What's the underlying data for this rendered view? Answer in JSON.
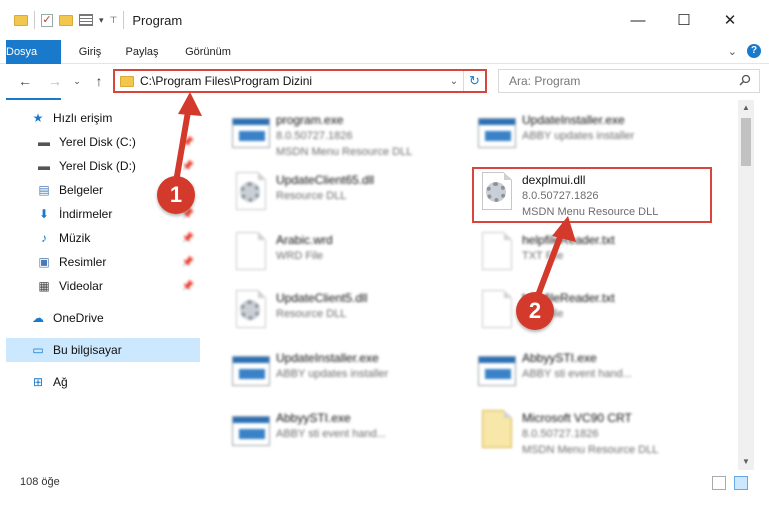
{
  "window": {
    "title": "Program"
  },
  "ribbon": {
    "tabs": [
      "Dosya",
      "Giriş",
      "Paylaş",
      "Görünüm"
    ]
  },
  "address": {
    "path": "C:\\Program Files\\Program Dizini"
  },
  "search": {
    "placeholder": "Ara: Program"
  },
  "sidebar": {
    "items": [
      {
        "label": "Hızlı erişim",
        "icon": "star-icon"
      },
      {
        "label": "Yerel Disk (C:)",
        "icon": "drive-icon"
      },
      {
        "label": "Yerel Disk (D:)",
        "icon": "drive-icon"
      },
      {
        "label": "Belgeler",
        "icon": "documents-icon"
      },
      {
        "label": "İndirmeler",
        "icon": "download-icon"
      },
      {
        "label": "Müzik",
        "icon": "music-icon"
      },
      {
        "label": "Resimler",
        "icon": "pictures-icon"
      },
      {
        "label": "Videolar",
        "icon": "video-icon"
      },
      {
        "label": "OneDrive",
        "icon": "cloud-icon"
      },
      {
        "label": "Bu bilgisayar",
        "icon": "computer-icon"
      },
      {
        "label": "Ağ",
        "icon": "network-icon"
      }
    ]
  },
  "files": [
    {
      "name": "program.exe",
      "line2": "8.0.50727.1826",
      "line3": "MSDN Menu Resource DLL",
      "icon": "exe-icon"
    },
    {
      "name": "UpdateInstaller.exe",
      "line2": "ABBY updates installer",
      "line3": "",
      "icon": "exe-icon"
    },
    {
      "name": "UpdateClient65.dll",
      "line2": "Resource DLL",
      "line3": "",
      "icon": "dll-icon"
    },
    {
      "name": "dexplmui.dll",
      "line2": "8.0.50727.1826",
      "line3": "MSDN Menu Resource DLL",
      "icon": "dll-icon"
    },
    {
      "name": "Arabic.wrd",
      "line2": "WRD File",
      "line3": "",
      "icon": "document-icon"
    },
    {
      "name": "helpfileReader.txt",
      "line2": "TXT File",
      "line3": "",
      "icon": "document-icon"
    },
    {
      "name": "UpdateClient5.dll",
      "line2": "Resource DLL",
      "line3": "",
      "icon": "dll-icon"
    },
    {
      "name": "helpfileReader.txt",
      "line2": "TXT File",
      "line3": "",
      "icon": "document-icon"
    },
    {
      "name": "UpdateInstaller.exe",
      "line2": "ABBY updates installer",
      "line3": "",
      "icon": "exe-icon"
    },
    {
      "name": "AbbyySTI.exe",
      "line2": "ABBY sti event hand...",
      "line3": "",
      "icon": "exe-icon"
    },
    {
      "name": "AbbyySTI.exe",
      "line2": "ABBY sti event hand...",
      "line3": "",
      "icon": "exe-icon"
    },
    {
      "name": "Microsoft VC90 CRT",
      "line2": "8.0.50727.1826",
      "line3": "MSDN Menu Resource DLL",
      "icon": "folder-icon"
    }
  ],
  "status": {
    "count": "108 öğe"
  },
  "annotations": {
    "step1": "1",
    "step2": "2",
    "color": "#d33a2c"
  },
  "colors": {
    "accent": "#1979ca",
    "highlight": "#d9443c",
    "selection": "#cce8ff"
  }
}
